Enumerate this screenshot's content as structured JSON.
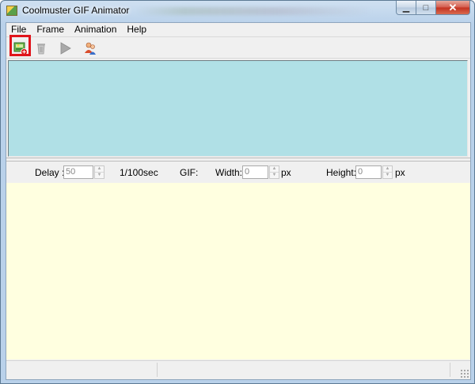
{
  "window": {
    "title": "Coolmuster GIF Animator",
    "controls": {
      "minimize": "▁",
      "maximize": "□",
      "close": "✕"
    }
  },
  "menu": [
    {
      "label": "File"
    },
    {
      "label": "Frame"
    },
    {
      "label": "Animation"
    },
    {
      "label": "Help"
    }
  ],
  "toolbar": {
    "tools": [
      {
        "icon": "add-images-icon",
        "highlighted": true
      },
      {
        "icon": "delete-icon",
        "disabled": true
      },
      {
        "icon": "play-icon",
        "disabled": true
      },
      {
        "icon": "users-icon"
      }
    ]
  },
  "properties": {
    "delay_label": "Delay :",
    "delay_value": "50",
    "delay_unit": "1/100sec",
    "gif_label": "GIF:",
    "width_label": "Width:",
    "width_value": "0",
    "width_unit": "px",
    "height_label": "Height:",
    "height_value": "0",
    "height_unit": "px"
  },
  "colors": {
    "frames_panel": "#b0e0e6",
    "preview_area": "#ffffe0",
    "highlight": "#e0141b"
  }
}
